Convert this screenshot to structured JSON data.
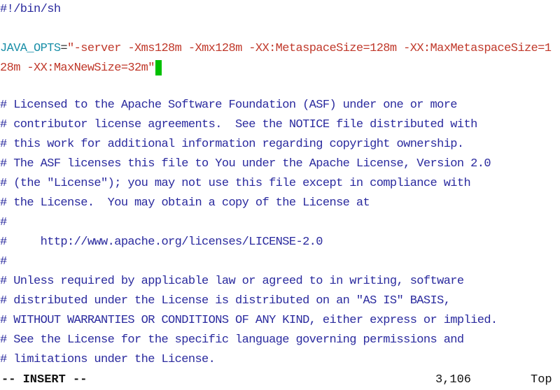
{
  "editor": {
    "shebang": "#!/bin/sh",
    "java_opts": {
      "name": "JAVA_OPTS",
      "operator": "=",
      "value_line1": "\"-server -Xms128m -Xmx128m -XX:MetaspaceSize=128m -XX:MaxMetaspaceSize=1",
      "value_line2": "28m -XX:MaxNewSize=32m\""
    },
    "comments": [
      "# Licensed to the Apache Software Foundation (ASF) under one or more",
      "# contributor license agreements.  See the NOTICE file distributed with",
      "# this work for additional information regarding copyright ownership.",
      "# The ASF licenses this file to You under the Apache License, Version 2.0",
      "# (the \"License\"); you may not use this file except in compliance with",
      "# the License.  You may obtain a copy of the License at",
      "#",
      "#     http://www.apache.org/licenses/LICENSE-2.0",
      "#",
      "# Unless required by applicable law or agreed to in writing, software",
      "# distributed under the License is distributed on an \"AS IS\" BASIS,",
      "# WITHOUT WARRANTIES OR CONDITIONS OF ANY KIND, either express or implied.",
      "# See the License for the specific language governing permissions and",
      "# limitations under the License."
    ]
  },
  "status": {
    "mode": "-- INSERT --",
    "position": "3,106",
    "scroll": "Top"
  },
  "colors": {
    "comment": "#2a2a9e",
    "variable": "#1a8fa8",
    "string": "#c0392b",
    "cursor": "#00c000"
  }
}
